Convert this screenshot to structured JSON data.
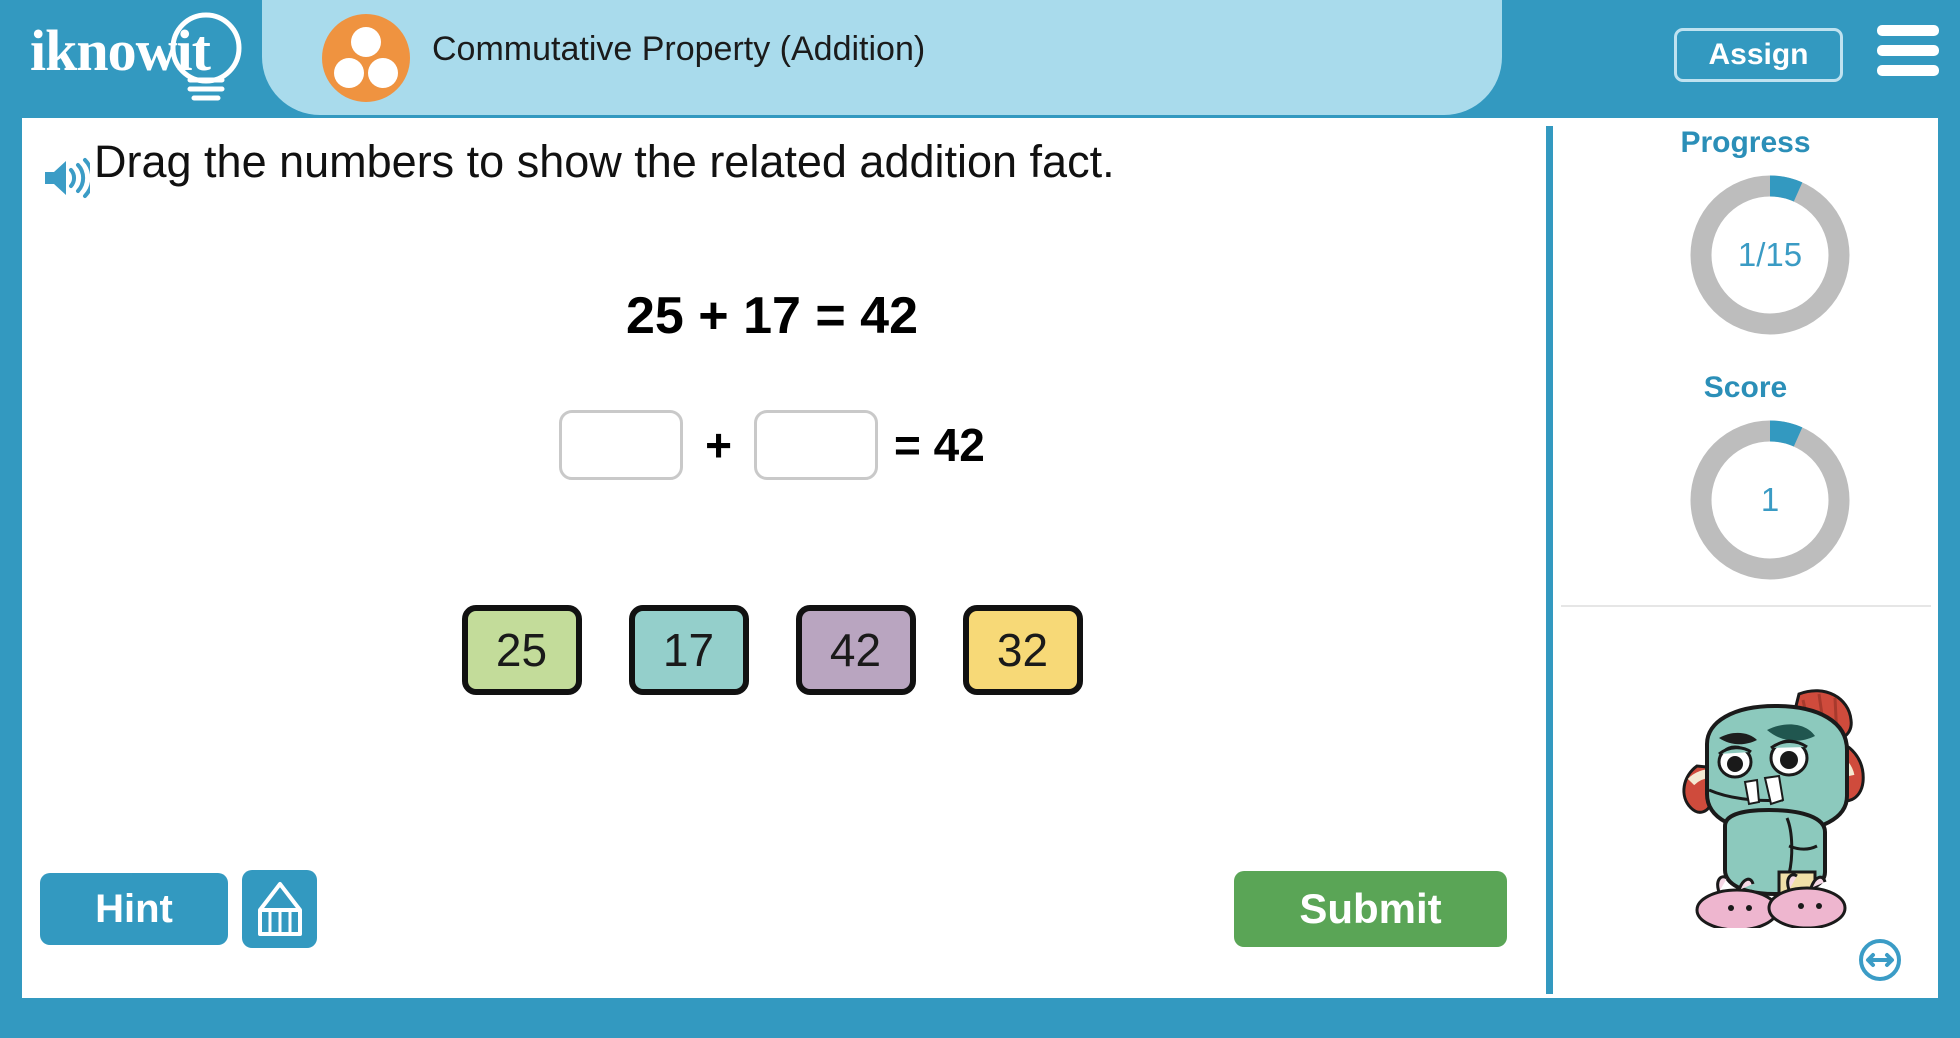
{
  "header": {
    "logo_text": "iknowit",
    "logo_icon": "lightbulb-icon",
    "lesson_icon": "three-dots-cluster-icon",
    "lesson_title": "Commutative Property (Addition)",
    "assign_label": "Assign",
    "menu_icon": "hamburger-menu-icon",
    "bar_color": "#3399c0",
    "pill_color": "#a9dbec",
    "lesson_icon_color": "#ef9340"
  },
  "question": {
    "audio_icon": "speaker-icon",
    "prompt": "Drag the numbers to show the related addition fact.",
    "given_equation": "25 + 17 = 42",
    "answer_operator": "+",
    "answer_tail": "= 42",
    "dropbox_count": 2,
    "dropbox_values": [
      "",
      ""
    ]
  },
  "tiles": [
    {
      "value": "25",
      "color": "#c3dc9a"
    },
    {
      "value": "17",
      "color": "#94cfcb"
    },
    {
      "value": "42",
      "color": "#b9a5c0"
    },
    {
      "value": "32",
      "color": "#f7d977"
    }
  ],
  "actions": {
    "hint_label": "Hint",
    "scratchpad_icon": "pencil-icon",
    "submit_label": "Submit",
    "hint_color": "#3399c0",
    "submit_color": "#5aa556"
  },
  "sidebar": {
    "progress_label": "Progress",
    "progress_value": "1/15",
    "progress_current": 1,
    "progress_total": 15,
    "score_label": "Score",
    "score_value": "1",
    "score_current": 1,
    "score_total": 15,
    "ring_track_color": "#bdbdbd",
    "ring_fill_color": "#3399c0",
    "accent_color": "#2b8fb8",
    "mascot_icon": "monster-mascot-character",
    "resize_icon": "horizontal-resize-icon"
  }
}
